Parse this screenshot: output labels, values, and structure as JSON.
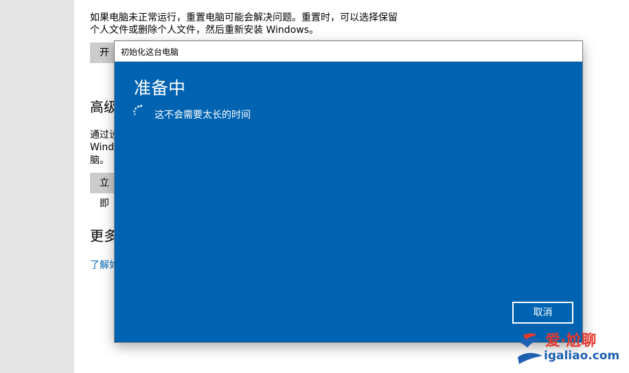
{
  "settings": {
    "reset_desc_line1": "如果电脑未正常运行，重置电脑可能会解决问题。重置时，可以选择保留",
    "reset_desc_line2": "个人文件或删除个人文件，然后重新安装 Windows。",
    "reset_button_label": "开",
    "advanced_heading": "高级",
    "advanced_desc_line1": "通过设",
    "advanced_desc_line2": "Windo",
    "advanced_desc_line3": "脑。",
    "restart_button_label": "立即",
    "more_heading": "更多",
    "learn_more_link": "了解如"
  },
  "dialog": {
    "title": "初始化这台电脑",
    "heading": "准备中",
    "subtext": "这不会需要太长的时间",
    "cancel_label": "取消"
  },
  "watermark": {
    "brand_text": "爱·尬聊",
    "url": "igaliao.com"
  },
  "colors": {
    "dialog_bg": "#0063b1",
    "link": "#0067b8",
    "sidebar_bg": "#e6e6e6"
  }
}
